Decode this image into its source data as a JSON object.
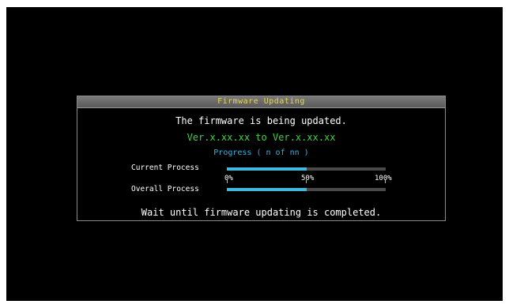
{
  "dialog": {
    "title": "Firmware Updating",
    "message": "The firmware is being updated.",
    "version_line": "Ver.x.xx.xx to Ver.x.xx.xx",
    "progress_title": "Progress ( n of nn )",
    "current_label": "Current Process",
    "overall_label": "Overall Process",
    "scale": [
      "0%",
      "50%",
      "100%"
    ],
    "current_progress": 0.5,
    "overall_progress": 0.5,
    "footer": "Wait until firmware updating is completed."
  },
  "colors": {
    "title_text": "#e8d84a",
    "version_text": "#3fd43f",
    "progress_text": "#2fb6e6",
    "bar_fill": "#3fb9e0"
  }
}
